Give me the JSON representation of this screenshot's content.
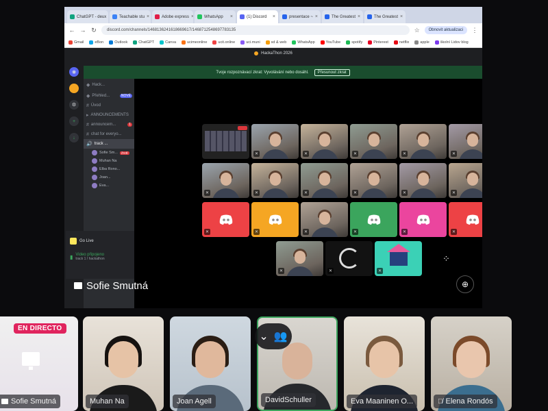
{
  "browser": {
    "tabs": [
      {
        "label": "ChatGPT - deux",
        "color": "#10a37f"
      },
      {
        "label": "Teachable stu",
        "color": "#3b82f6"
      },
      {
        "label": "Adobe express",
        "color": "#e11d48"
      },
      {
        "label": "WhatsApp",
        "color": "#22c55e"
      },
      {
        "label": "(1) Discord",
        "color": "#5865f2"
      },
      {
        "label": "presentace ~",
        "color": "#2563eb"
      },
      {
        "label": "The Greatest",
        "color": "#2563eb"
      },
      {
        "label": "The Greatest",
        "color": "#2563eb"
      }
    ],
    "url": "discord.com/channels/1468136241618669617/1468712548697783135",
    "profile_chip": "Obnovit aktualizaci",
    "bookmarks": [
      {
        "label": "Gmail",
        "color": "#ea4335"
      },
      {
        "label": "eBon",
        "color": "#0ea5e9"
      },
      {
        "label": "Outlook",
        "color": "#0078d4"
      },
      {
        "label": "ChatGPT",
        "color": "#10a37f"
      },
      {
        "label": "Canva",
        "color": "#00c4cc"
      },
      {
        "label": "ucimeonline",
        "color": "#f97316"
      },
      {
        "label": "ucit.online",
        "color": "#ef4444"
      },
      {
        "label": "uci.muni",
        "color": "#8b5cf6"
      },
      {
        "label": "sd & web",
        "color": "#f59e0b"
      },
      {
        "label": "WhatsApp",
        "color": "#22c55e"
      },
      {
        "label": "YouTube",
        "color": "#ff0000"
      },
      {
        "label": "spotify",
        "color": "#1db954"
      },
      {
        "label": "Pinterest",
        "color": "#e60023"
      },
      {
        "label": "netflix",
        "color": "#e50914"
      },
      {
        "label": "apple",
        "color": "#888888"
      },
      {
        "label": "školní Lidov blog",
        "color": "#7c3aed"
      }
    ]
  },
  "discord": {
    "server_title": "HackaThon 2026",
    "notice_text": "Tvoje rozpoznávací zkrat: Vyvolávání nebo dosáhl.",
    "notice_button": "Přesunout zkrat",
    "channels": [
      {
        "label": "Hack...",
        "type": "server"
      },
      {
        "label": "Přehled...",
        "type": "server-sub",
        "badge": "NOVÉ"
      },
      {
        "label": "Úvod",
        "type": "text"
      },
      {
        "label": "ANNOUNCEMENTS",
        "type": "category"
      },
      {
        "label": "announcem...",
        "type": "text",
        "unread": "1"
      },
      {
        "label": "chat for everyo...",
        "type": "text"
      },
      {
        "label": "track ...",
        "type": "voice",
        "selected": true
      }
    ],
    "members": [
      {
        "label": "Sofie Sm...",
        "live": "ŽIVĚ"
      },
      {
        "label": "Muhan Na"
      },
      {
        "label": "Elba Rono..."
      },
      {
        "label": "Joan..."
      },
      {
        "label": "Eva..."
      }
    ],
    "go_live_label": "Go Live",
    "voice_status": "Video připojeno",
    "voice_sub": "track 1 / hackathon"
  },
  "stage": {
    "presenter_name": "Sofie Smutná"
  },
  "filmstrip": {
    "live_badge": "EN DIRECTO",
    "participants": [
      {
        "name": "Sofie Smutná",
        "presenting": true
      },
      {
        "name": "Muhan Na"
      },
      {
        "name": "Joan Agell"
      },
      {
        "name": "DavidSchuller"
      },
      {
        "name": "Eva Maaninen O..."
      },
      {
        "name": "Elena Rondós",
        "muted": true
      }
    ]
  },
  "colors": {
    "discord_blurple": "#5865f2",
    "discord_red": "#ed4245",
    "discord_orange": "#f5a623",
    "discord_green": "#3ba55d",
    "discord_pink": "#eb459e",
    "live_red": "#e0245e",
    "speaking_green": "#3ba55d"
  }
}
